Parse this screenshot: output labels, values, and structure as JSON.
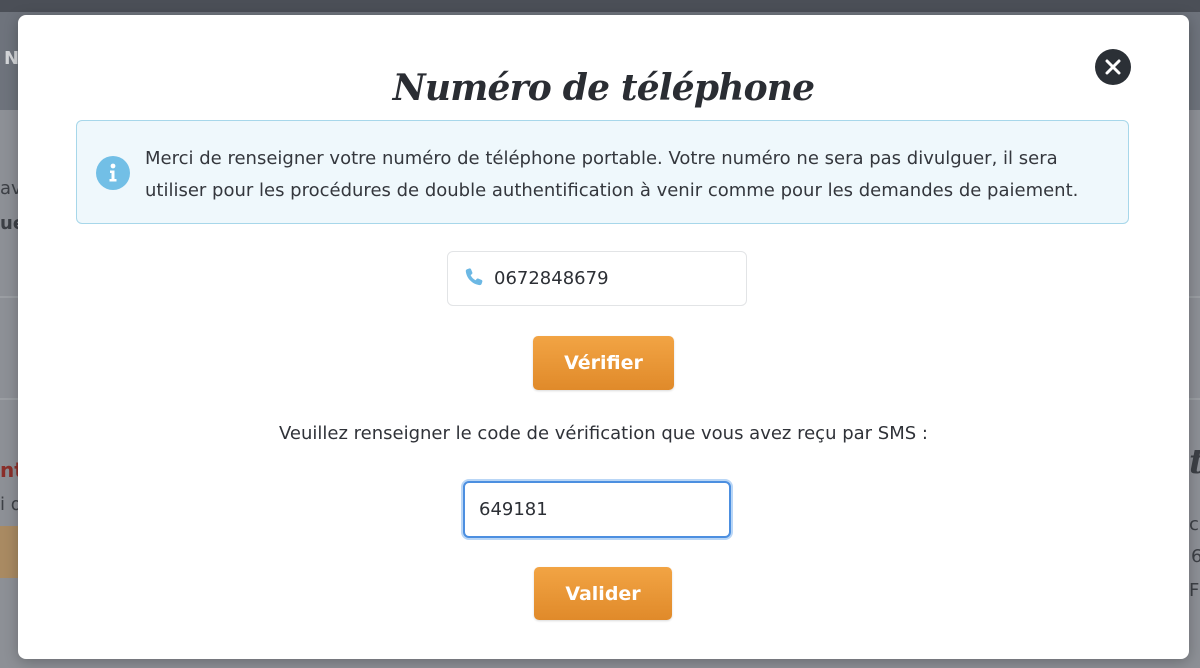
{
  "background": {
    "fragments": [
      "N",
      "av",
      "ue",
      "nt",
      "i d",
      "t",
      "ch",
      "6",
      "F"
    ]
  },
  "modal": {
    "title": "Numéro de téléphone",
    "close_icon": "close-icon",
    "info_icon": "info-icon",
    "info_text": "Merci de renseigner votre numéro de téléphone portable. Votre numéro ne sera pas divulguer, il sera utiliser pour les procédures de double authentification à venir comme pour les demandes de paiement.",
    "phone_icon": "phone-icon",
    "phone_value": "0672848679",
    "verify_label": "Vérifier",
    "sms_label": "Veuillez renseigner le code de vérification que vous avez reçu par SMS :",
    "code_value": "649181",
    "validate_label": "Valider"
  },
  "colors": {
    "accent_orange": "#e8942f",
    "info_bg": "#eff8fc",
    "info_border": "#a7d7ea",
    "info_icon": "#72bfe6",
    "focus_border": "#4c8fe0",
    "overlay": "#8d9096"
  }
}
